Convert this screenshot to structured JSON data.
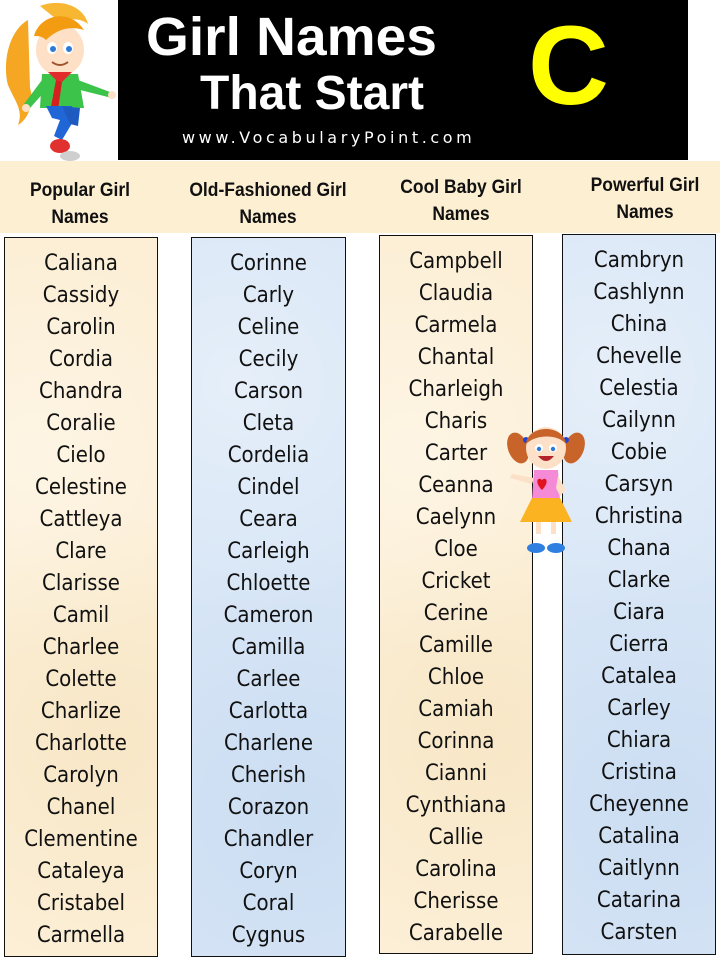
{
  "banner": {
    "title_line1": "Girl Names",
    "title_line2": "That Start",
    "letter": "C",
    "website": "www.VocabularyPoint.com",
    "accent_color": "#ffff00"
  },
  "columns": [
    {
      "heading_line1": "Popular Girl",
      "heading_line2": "Names",
      "theme": "beige",
      "names": [
        "Caliana",
        "Cassidy",
        "Carolin",
        "Cordia",
        "Chandra",
        "Coralie",
        "Cielo",
        "Celestine",
        "Cattleya",
        "Clare",
        "Clarisse",
        "Camil",
        "Charlee",
        "Colette",
        "Charlize",
        "Charlotte",
        "Carolyn",
        "Chanel",
        "Clementine",
        "Cataleya",
        "Cristabel",
        "Carmella"
      ]
    },
    {
      "heading_line1": "Old-Fashioned Girl",
      "heading_line2": "Names",
      "theme": "blue",
      "names": [
        "Corinne",
        "Carly",
        "Celine",
        "Cecily",
        "Carson",
        "Cleta",
        "Cordelia",
        "Cindel",
        "Ceara",
        "Carleigh",
        "Chloette",
        "Cameron",
        "Camilla",
        "Carlee",
        "Carlotta",
        "Charlene",
        "Cherish",
        "Corazon",
        "Chandler",
        "Coryn",
        "Coral",
        "Cygnus"
      ]
    },
    {
      "heading_line1": "Cool Baby Girl",
      "heading_line2": "Names",
      "theme": "beige",
      "names": [
        "Campbell",
        "Claudia",
        "Carmela",
        "Chantal",
        "Charleigh",
        "Charis",
        "Carter",
        "Ceanna",
        "Caelynn",
        "Cloe",
        "Cricket",
        "Cerine",
        "Camille",
        "Chloe",
        "Camiah",
        "Corinna",
        "Cianni",
        "Cynthiana",
        "Callie",
        "Carolina",
        "Cherisse",
        "Carabelle"
      ]
    },
    {
      "heading_line1": "Powerful Girl",
      "heading_line2": "Names",
      "theme": "blue",
      "names": [
        "Cambryn",
        "Cashlynn",
        "China",
        "Chevelle",
        "Celestia",
        "Cailynn",
        "Cobie",
        "Carsyn",
        "Christina",
        "Chana",
        "Clarke",
        "Ciara",
        "Cierra",
        "Catalea",
        "Carley",
        "Chiara",
        "Cristina",
        "Cheyenne",
        "Catalina",
        "Caitlynn",
        "Catarina",
        "Carsten"
      ]
    }
  ],
  "illustrations": {
    "top_left": "cartoon-girl-orange-hair-icon",
    "middle": "cartoon-girl-pigtails-icon"
  }
}
